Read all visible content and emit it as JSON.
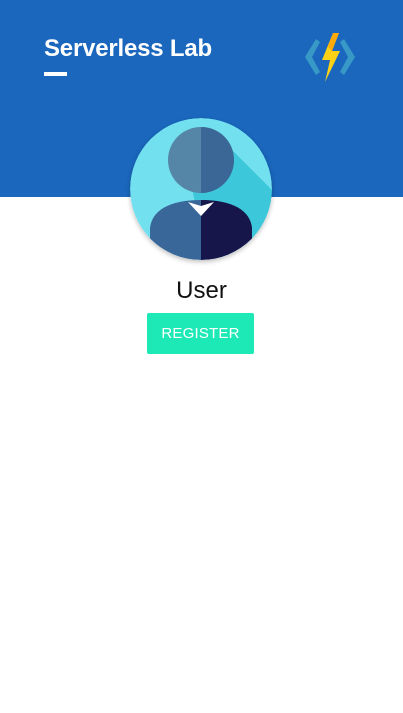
{
  "header": {
    "title": "Serverless Lab",
    "logo_icon": "azure-functions-logo-icon",
    "background_color": "#1a67bd"
  },
  "profile": {
    "avatar_icon": "user-avatar-icon",
    "username": "User",
    "register_label": "REGISTER",
    "accent_color": "#1de9b6"
  }
}
